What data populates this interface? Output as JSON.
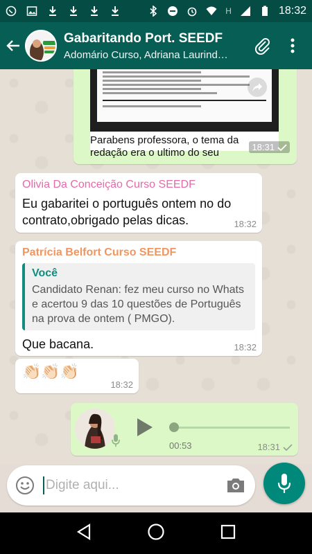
{
  "status_bar": {
    "time": "18:32",
    "network_label": "H"
  },
  "header": {
    "title": "Gabaritando Port. SEEDF",
    "subtitle": "Adomário Curso, Adriana Laurind…"
  },
  "messages": {
    "image_msg": {
      "caption": "Parabens professora, o tema da redação era o ultimo do seu",
      "time": "18:31"
    },
    "olivia": {
      "sender": "Olivia Da Conceição Curso SEEDF",
      "sender_color": "#e56aa8",
      "text": "Eu gabaritei o português ontem no do contrato,obrigado pelas dicas.",
      "time": "18:32"
    },
    "patricia": {
      "sender": "Patrícia Belfort Curso SEEDF",
      "sender_color": "#f2955f",
      "quote_author": "Você",
      "quote_text": "Candidato Renan: fez meu curso no Whats e acertou 9 das 10 questões de Português na prova de ontem ( PMGO).",
      "text": "Que bacana.",
      "time": "18:32"
    },
    "emoji_msg": {
      "text": "👏🏻👏🏻👏🏻",
      "time": "18:32"
    },
    "voice_msg": {
      "duration": "00:53",
      "time": "18:31",
      "progress": 0
    }
  },
  "composer": {
    "placeholder": "Digite aqui..."
  },
  "colors": {
    "header": "#075e54",
    "accent": "#00897b",
    "outgoing": "#dcf8c6"
  }
}
